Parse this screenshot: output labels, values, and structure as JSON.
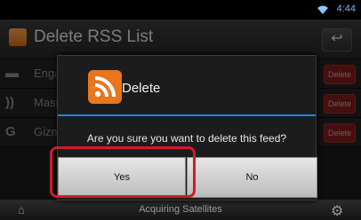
{
  "status_bar": {
    "time": "4:44",
    "wifi_icon": "wifi-icon"
  },
  "header": {
    "title": "Delete RSS List",
    "back_icon": "back-arrow-icon"
  },
  "list": {
    "rows": [
      {
        "name": "Engadget",
        "delete_label": "Delete"
      },
      {
        "name": "Mashable",
        "delete_label": "Delete"
      },
      {
        "name": "Gizmodo",
        "delete_label": "Delete"
      }
    ]
  },
  "dialog": {
    "title": "Delete",
    "message": "Are you sure you want to delete this feed?",
    "yes_label": "Yes",
    "no_label": "No"
  },
  "bottom_bar": {
    "gps_status": "Acquiring Satellites"
  },
  "colors": {
    "accent": "#2b80d6",
    "highlight": "#d01c2a",
    "rss": "#e8761e"
  }
}
